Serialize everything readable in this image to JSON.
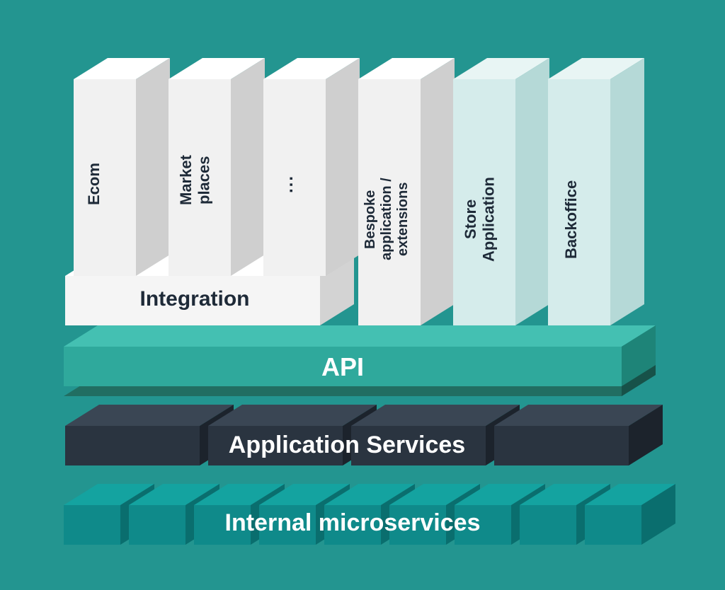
{
  "layers": {
    "microservices": "Internal microservices",
    "app_services": "Application Services",
    "api": "API",
    "integration": "Integration"
  },
  "pillars": [
    {
      "label": "Ecom"
    },
    {
      "label": "Market\nplaces"
    },
    {
      "label": "..."
    },
    {
      "label": "Bespoke\napplication /\nextensions"
    },
    {
      "label": "Store\nApplication"
    },
    {
      "label": "Backoffice"
    }
  ],
  "colors": {
    "bg": "#239590",
    "micro_front": "#0f8a8a",
    "micro_top": "#14a3a0",
    "micro_side": "#0a6e6e",
    "appsvc_front": "#2a3440",
    "appsvc_top": "#3a4654",
    "appsvc_side": "#1c232c",
    "api_front": "#2fa99c",
    "api_top": "#44c0b2",
    "api_side": "#1e8478",
    "api_under_top": "#216e62",
    "api_under_side": "#175249",
    "pillar_front": "#f1f1f1",
    "pillar_top": "#ffffff",
    "pillar_side": "#cfcfcf",
    "pillar2_front": "#d5eceb",
    "pillar2_top": "#e8f5f4",
    "pillar2_side": "#b5d9d7",
    "integ_front": "#f5f5f5",
    "integ_top": "#ffffff",
    "integ_side": "#d3d3d3"
  }
}
